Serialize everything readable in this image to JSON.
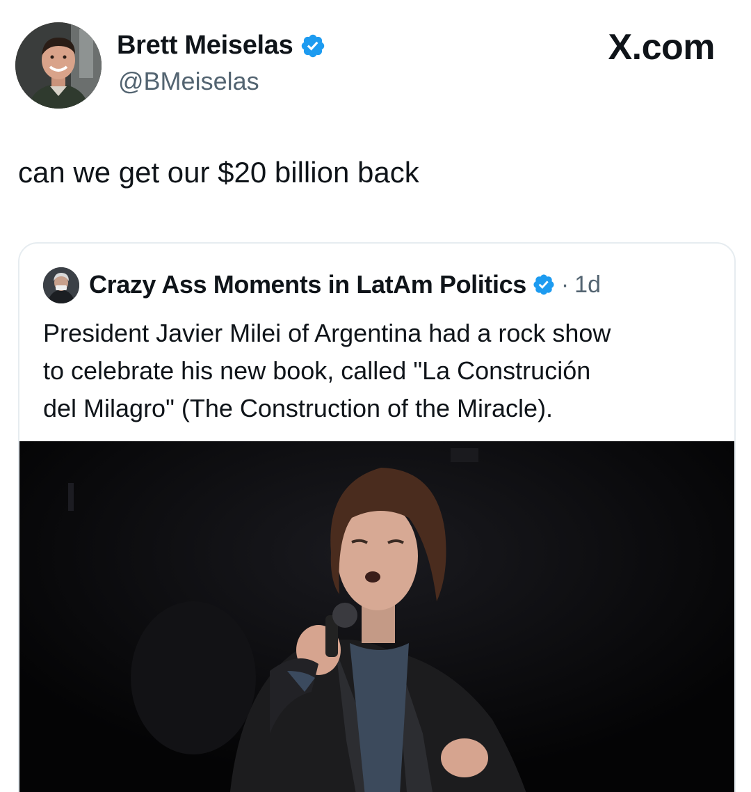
{
  "author": {
    "name": "Brett Meiselas",
    "handle": "@BMeiselas",
    "verified_icon": "verified-badge-icon"
  },
  "brand": "X.com",
  "post": {
    "text": "can we get our $20 billion back"
  },
  "quoted": {
    "name": "Crazy Ass Moments in LatAm Politics",
    "separator": "·",
    "time": "1d",
    "text_lines": [
      "President Javier Milei of Argentina had a rock show",
      "to celebrate his new book, called \"La Construción",
      "del Milagro\" (The Construction of the Miracle)."
    ],
    "media_description_icon": "video-still-image"
  },
  "colors": {
    "verified_blue": "#1d9bf0",
    "text_primary": "#0f1419",
    "text_secondary": "#536471",
    "card_border": "#e6ecf0"
  }
}
